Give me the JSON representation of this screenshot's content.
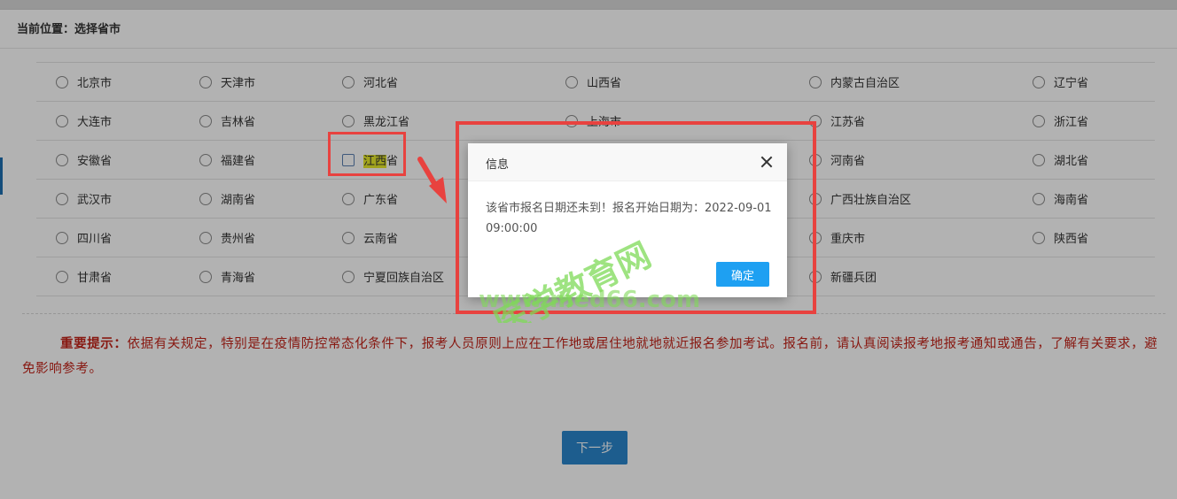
{
  "breadcrumb": "当前位置：选择省市",
  "regions": [
    [
      "北京市",
      "天津市",
      "河北省",
      "山西省",
      "内蒙古自治区",
      "辽宁省"
    ],
    [
      "大连市",
      "吉林省",
      "黑龙江省",
      "上海市",
      "江苏省",
      "浙江省"
    ],
    [
      "安徽省",
      "福建省",
      "江西省",
      "",
      "河南省",
      "湖北省"
    ],
    [
      "武汉市",
      "湖南省",
      "广东省",
      "",
      "广西壮族自治区",
      "海南省"
    ],
    [
      "四川省",
      "贵州省",
      "云南省",
      "",
      "重庆市",
      "陕西省"
    ],
    [
      "甘肃省",
      "青海省",
      "宁夏回族自治区",
      "",
      "新疆兵团",
      ""
    ]
  ],
  "notice": {
    "label": "重要提示：",
    "text": "依据有关规定，特别是在疫情防控常态化条件下，报考人员原则上应在工作地或居住地就地就近报名参加考试。报名前，请认真阅读报考地报考通知或通告，了解有关要求，避免影响参考。"
  },
  "next_button": "下一步",
  "dialog": {
    "title": "信息",
    "message": "该省市报名日期还未到！报名开始日期为：2022-09-01 09:00:00",
    "ok_label": "确定"
  },
  "watermark": {
    "line1": "医学教育网",
    "line2": "www.med66.com"
  },
  "colors": {
    "accent": "#1ea0f2",
    "primary_button": "#2a86cc",
    "notice_text": "#c3251b",
    "annotation_red": "#e8423f",
    "highlight_yellow": "#e7ea2a",
    "watermark_green": "#7ed957"
  }
}
